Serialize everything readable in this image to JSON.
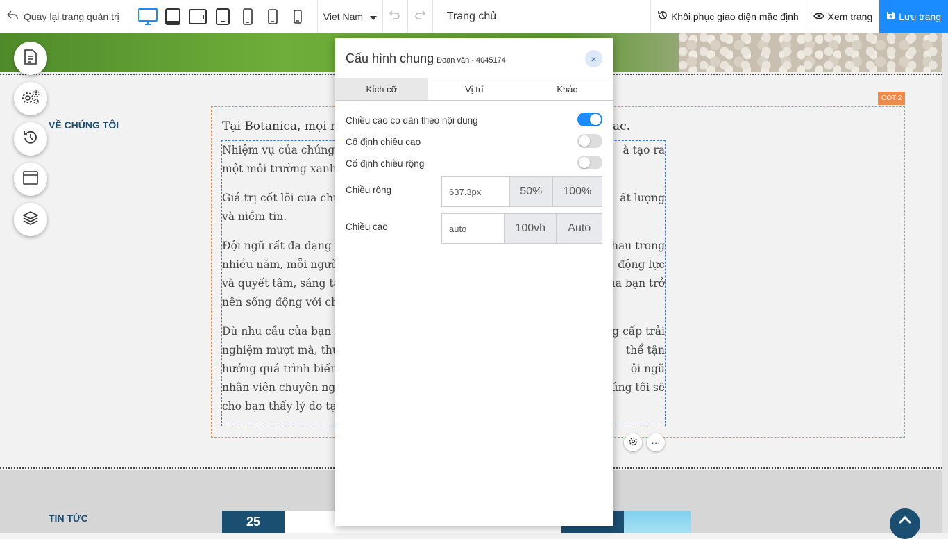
{
  "toolbar": {
    "back_label": "Quay lại trang quản trị",
    "language": "Viet Nam",
    "page_title": "Trang chủ",
    "restore_label": "Khôi phục giao diện mặc định",
    "preview_label": "Xem trang",
    "save_label": "Lưu trang",
    "accent": "#1a8cff",
    "devices": [
      "desktop-icon",
      "tablet-landscape-icon",
      "tablet-wide-icon",
      "tablet-portrait-icon",
      "phone-large-icon",
      "phone-medium-icon",
      "phone-small-icon"
    ]
  },
  "page": {
    "about_title": "VỀ CHÚNG TÔI",
    "column_badge": "COT 2",
    "lead_text": "Tại Botanica, mọi ngư",
    "lead_end": "ac.",
    "paragraph_left": [
      "Nhiệm vụ của chúng tô",
      "một môi trường xanh gi",
      "Giá trị cốt lõi của chúng",
      "và niềm tin.",
      "Đội ngũ rất đa dạng và",
      "nhiều năm, mỗi người c",
      "và quyết tâm, sáng tạo",
      "nên sống động với chún",
      "Dù nhu cầu của bạn là",
      "nghiệm mượt mà, thú v",
      "hưởng quá trình biến đ",
      "nhân viên chuyên nghiệ",
      "cho bạn thấy lý do tại s"
    ],
    "paragraph_right": [
      "à tạo ra",
      "",
      "ất lượng",
      "",
      "hau trong",
      "động lực",
      "của bạn trở",
      "",
      "g cấp trải",
      "thể tận",
      "ội ngũ",
      "úng tôi sẽ",
      ""
    ],
    "news_title": "TIN TỨC",
    "news_date": "25",
    "brand_color": "#1b4f72"
  },
  "side_tools": [
    "document-icon",
    "settings-icon",
    "history-icon",
    "layout-icon",
    "layers-icon"
  ],
  "modal": {
    "title": "Cấu hình chung",
    "subtitle": "Đoạn văn - 4045174",
    "close": "×",
    "tabs": [
      "Kích cỡ",
      "Vị trí",
      "Khác"
    ],
    "active_tab": "Kích cỡ",
    "options": [
      {
        "label": "Chiều cao co dãn theo nội dung",
        "enabled": true
      },
      {
        "label": "Cố định chiều cao",
        "enabled": false
      },
      {
        "label": "Cố định chiều rộng",
        "enabled": false
      }
    ],
    "width": {
      "label": "Chiều rộng",
      "value": "637.3px",
      "presets": [
        "50%",
        "100%"
      ]
    },
    "height": {
      "label": "Chiều cao",
      "value": "auto",
      "presets": [
        "100vh",
        "Auto"
      ]
    }
  }
}
